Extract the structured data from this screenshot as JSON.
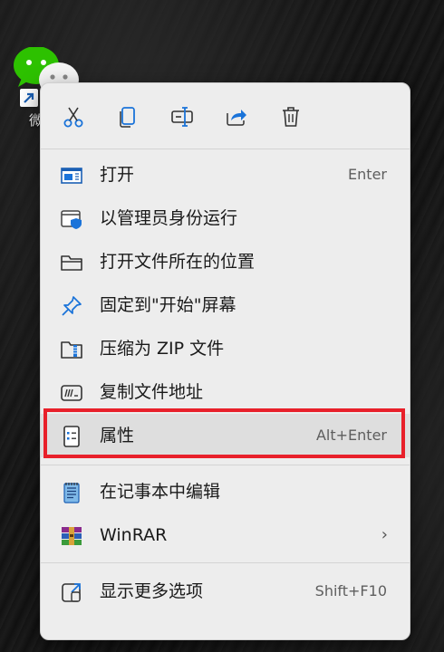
{
  "desktop_icon": {
    "label": "微",
    "brand_color": "#2dc100"
  },
  "context_menu": {
    "toolbar": [
      {
        "name": "cut-icon",
        "title": "剪切"
      },
      {
        "name": "copy-icon",
        "title": "复制"
      },
      {
        "name": "rename-icon",
        "title": "重命名"
      },
      {
        "name": "share-icon",
        "title": "共享"
      },
      {
        "name": "delete-icon",
        "title": "删除"
      }
    ],
    "items": [
      {
        "label": "打开",
        "shortcut": "Enter",
        "icon": "app-window-icon"
      },
      {
        "label": "以管理员身份运行",
        "shortcut": "",
        "icon": "admin-shield-icon"
      },
      {
        "label": "打开文件所在的位置",
        "shortcut": "",
        "icon": "folder-icon"
      },
      {
        "label": "固定到\"开始\"屏幕",
        "shortcut": "",
        "icon": "pin-icon"
      },
      {
        "label": "压缩为 ZIP 文件",
        "shortcut": "",
        "icon": "zip-folder-icon"
      },
      {
        "label": "复制文件地址",
        "shortcut": "",
        "icon": "copy-path-icon"
      },
      {
        "label": "属性",
        "shortcut": "Alt+Enter",
        "icon": "properties-icon",
        "highlighted": true
      },
      {
        "label": "在记事本中编辑",
        "shortcut": "",
        "icon": "notepad-icon"
      },
      {
        "label": "WinRAR",
        "shortcut": "",
        "icon": "winrar-icon",
        "has_submenu": true
      },
      {
        "label": "显示更多选项",
        "shortcut": "Shift+F10",
        "icon": "more-options-icon"
      }
    ],
    "highlight_color": "#e8202a",
    "accent_color": "#1a73d9"
  }
}
